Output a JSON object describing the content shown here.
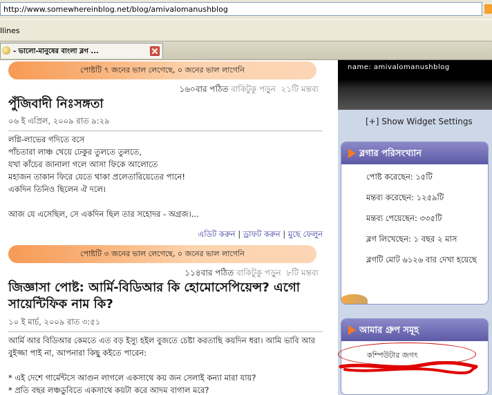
{
  "browser": {
    "url": "http://www.somewhereinblog.net/blog/amivalomanushblog",
    "links_label": "llines",
    "tab_title": "- ভালো-মানুষের বাংলা ব্লগ ...",
    "colors": {
      "chrome": "#ece9d8",
      "accent": "#f5a030"
    }
  },
  "posts": [
    {
      "likes_bar": "পোষ্টটি ৭ জনের ভাল লেগেছে, ০ জনের ভাল লাগেনি",
      "read_count": "১৬০বার পঠিত",
      "read_more": "বাকিটুকু পড়ুন",
      "comments": "২১টি মন্তব্য",
      "title": "পুঁজিবাদী নিঃসঙ্গতা",
      "date": "০৬ ই এপ্রিল, ২০০৯ রাত ৯:২৯",
      "lines": [
        "লগ্নি-লাভের গদিতে বসে",
        "পাঁচতারা লাঞ্চ খেয়ে ঢেকুর তুলতে তুলতে,",
        "যখা কাঁচের জানালা গলে আসা ফিকে আলোতে",
        "মহাজন তাকান ফিরে যেতে থাকা প্রলেতারিয়েতের পানে!",
        "একদিন তিনিও ছিলেন ঐ দলে।",
        "",
        "আজ যে এসেছিল, সে একদিন ছিল তার সহোদর - অগ্রজ।..."
      ],
      "actions": {
        "edit": "এডিট করুন",
        "draft": "ড্রাফট করুন",
        "delete": "মুছে ফেলুন"
      }
    },
    {
      "likes_bar": "পোষ্টটি ৩ জনের ভাল লেগেছে, ০ জনের ভাল লাগেনি",
      "read_count": "১১৪বার পঠিত",
      "read_more": "বাকিটুকু পড়ুন",
      "comments": "৮টি মন্তব্য",
      "title": "জিজ্ঞাসা পোষ্ট: আর্মি-বিডিআর কি হোমোসেপিয়েন্স? এগো সায়েন্টিফিক নাম কি?",
      "date": "১০ ই মার্চ, ২০০৯ রাত ৩:৫১",
      "lines": [
        "আর্মি আর বিডিআর কেমতে এত বড় ইস্যু হইল বুজতে চেষ্টা করতাছি কয়দিন ধরা। আমি ভাবি আর বুইজ্জা পাই না, আপনারা কিছু কইতে পারেন:",
        "",
        "* এই দেশে গার্মেন্টসে আগুন লাগলে একসাথে কয় জন সেলাই কন্যা মারা যায়?",
        "* প্রতি বছর লঞ্চডুবিতে একসাথে কয়টা করে আদম বাগাল মরে?"
      ]
    }
  ],
  "sidebar": {
    "name_line": "name:  amivalomanushblog",
    "widget_toggle": "[+] Show Widget Settings",
    "stats_title": "ব্লগার পরিসংখ্যান",
    "stats": [
      "পোষ্ট করেছেন: ১৫টি",
      "মন্তব্য করেছেন: ১২৫৯টি",
      "মন্তব্য পেয়েছেন: ৩৩৫টি",
      "ব্লগ লিখেছেন:  ১ বছর ২ মাস",
      "ব্লগটি মোট  ৬১২৬ বার দেখা হয়েছে"
    ],
    "groups_title": "আমার গ্রুপ সমূহ",
    "groups": [
      "কম্পিউটার জগৎ"
    ],
    "colors": {
      "panel_head": "#5d5aa6",
      "arrow": "#f47a20",
      "annotation": "#cc0000"
    }
  }
}
